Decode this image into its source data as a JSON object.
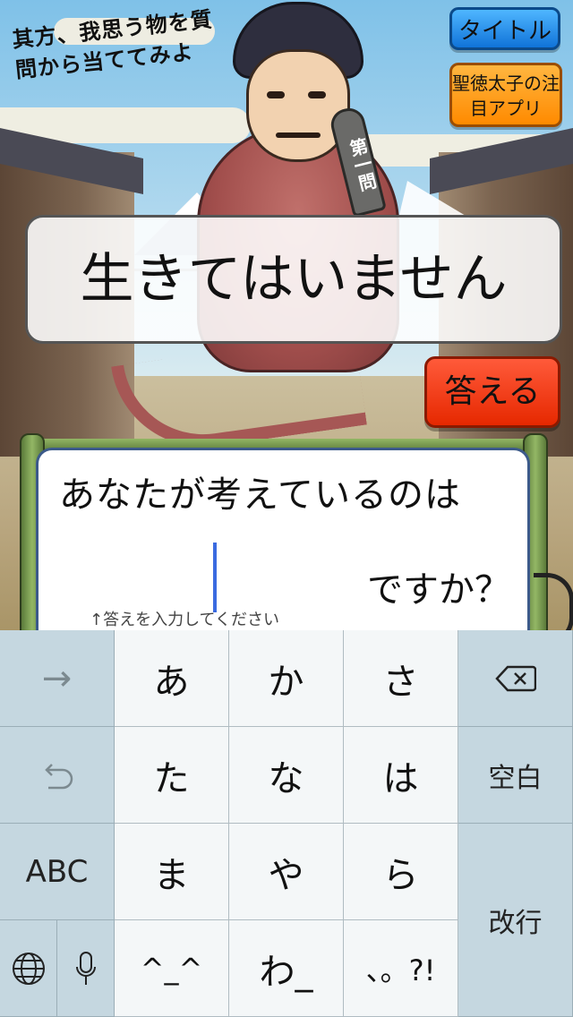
{
  "app": {
    "hint": "其方、我思う物を質問から当ててみよ",
    "title_button": "タイトル",
    "app_button": "聖徳太子の注目アプリ",
    "question_badge": "第一問"
  },
  "bubble": {
    "text": "生きてはいません"
  },
  "answer_button": "答える",
  "panel": {
    "question": "あなたが考えているのは",
    "suffix": "ですか？",
    "hint": "↑答えを入力してください",
    "input_value": ""
  },
  "keyboard": {
    "rows": [
      {
        "left": "→",
        "keys": [
          "あ",
          "か",
          "さ"
        ],
        "right": "⌫"
      },
      {
        "left": "↶",
        "keys": [
          "た",
          "な",
          "は"
        ],
        "right": "空白"
      },
      {
        "left": "ABC",
        "keys": [
          "ま",
          "や",
          "ら"
        ],
        "right": "改行"
      },
      {
        "left_globe": "🌐",
        "left_mic": "🎤",
        "keys": [
          "^_^",
          "わ_",
          "、。?!"
        ]
      }
    ]
  },
  "colors": {
    "title_button": "#1e8ef0",
    "app_button": "#ff9a10",
    "answer_button": "#f23a12",
    "caret": "#3a6ae0"
  }
}
